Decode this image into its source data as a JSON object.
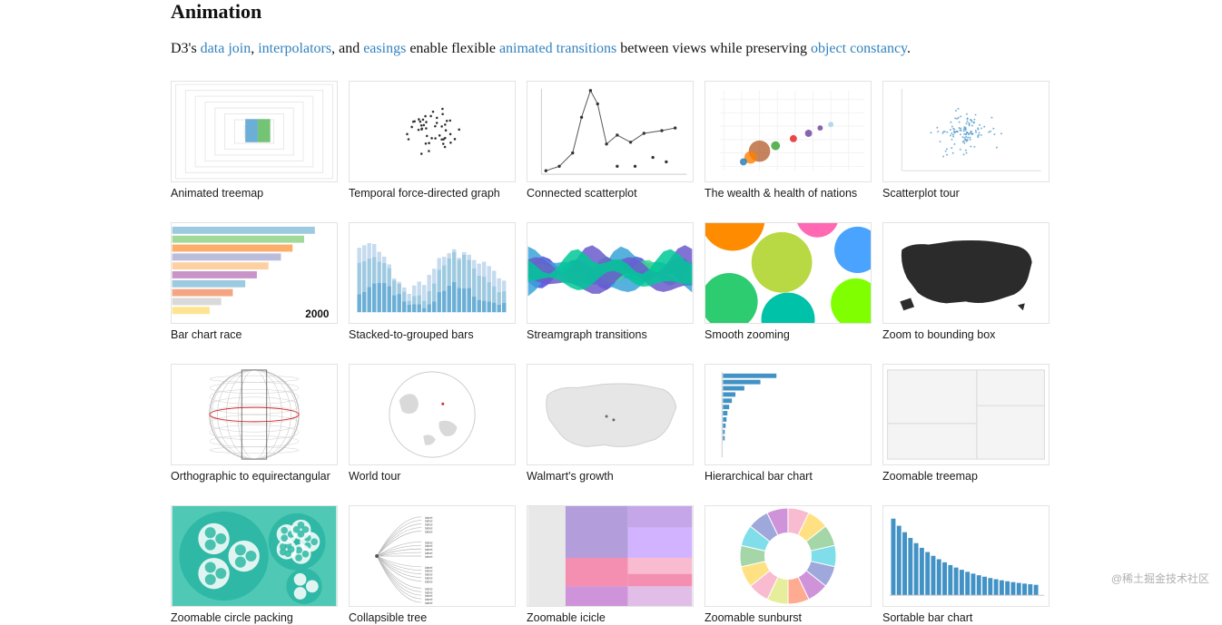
{
  "section": {
    "title": "Animation",
    "desc_prefix": "D3's ",
    "link_data_join": "data join",
    "comma1": ", ",
    "link_interpolators": "interpolators",
    "comma2": ", and ",
    "link_easings": "easings",
    "middle": " enable flexible ",
    "link_animated_transitions": "animated transitions",
    "suffix1": " between views while preserving ",
    "link_object_constancy": "object constancy",
    "period": "."
  },
  "cards": [
    {
      "label": "Animated treemap",
      "type": "treemap-anim"
    },
    {
      "label": "Temporal force-directed graph",
      "type": "force"
    },
    {
      "label": "Connected scatterplot",
      "type": "connected-scatter"
    },
    {
      "label": "The wealth & health of nations",
      "type": "nations"
    },
    {
      "label": "Scatterplot tour",
      "type": "scatter-tour"
    },
    {
      "label": "Bar chart race",
      "type": "bar-race"
    },
    {
      "label": "Stacked-to-grouped bars",
      "type": "stacked-grouped"
    },
    {
      "label": "Streamgraph transitions",
      "type": "streamgraph"
    },
    {
      "label": "Smooth zooming",
      "type": "smooth-zoom"
    },
    {
      "label": "Zoom to bounding box",
      "type": "usa-dark"
    },
    {
      "label": "Orthographic to equirectangular",
      "type": "globe-wire"
    },
    {
      "label": "World tour",
      "type": "world-tour"
    },
    {
      "label": "Walmart's growth",
      "type": "usa-light"
    },
    {
      "label": "Hierarchical bar chart",
      "type": "hier-bar"
    },
    {
      "label": "Zoomable treemap",
      "type": "zoom-treemap"
    },
    {
      "label": "Zoomable circle packing",
      "type": "circle-pack"
    },
    {
      "label": "Collapsible tree",
      "type": "coll-tree"
    },
    {
      "label": "Zoomable icicle",
      "type": "icicle"
    },
    {
      "label": "Zoomable sunburst",
      "type": "sunburst"
    },
    {
      "label": "Sortable bar chart",
      "type": "sortable-bar"
    }
  ],
  "watermark": "@稀土掘金技术社区",
  "bar_race_year": "2000"
}
